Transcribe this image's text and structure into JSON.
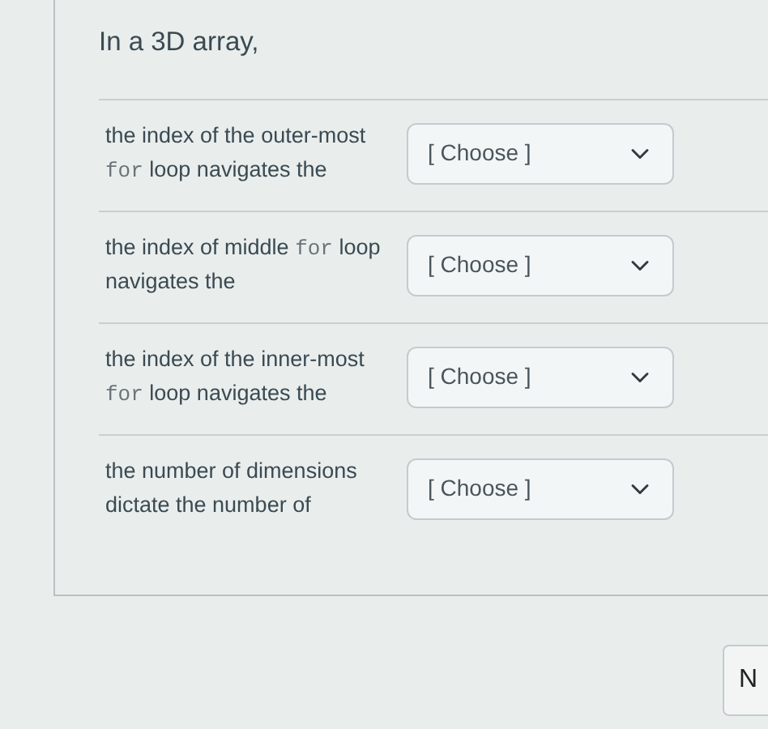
{
  "question": {
    "title": "In a 3D array,",
    "rows": [
      {
        "prompt": [
          {
            "text": "the index of the outer-most "
          },
          {
            "text": "for",
            "code": true
          },
          {
            "text": " loop navigates the"
          }
        ],
        "select": "[ Choose ]"
      },
      {
        "prompt": [
          {
            "text": "the index of middle "
          },
          {
            "text": "for",
            "code": true
          },
          {
            "text": " loop navigates the"
          }
        ],
        "select": "[ Choose ]"
      },
      {
        "prompt": [
          {
            "text": "the index of the inner-most "
          },
          {
            "text": "for",
            "code": true
          },
          {
            "text": " loop navigates the"
          }
        ],
        "select": "[ Choose ]"
      },
      {
        "prompt": [
          {
            "text": "the number of dimensions dictate the number of"
          }
        ],
        "select": "[ Choose ]"
      }
    ]
  },
  "next_button": {
    "label": "N"
  }
}
